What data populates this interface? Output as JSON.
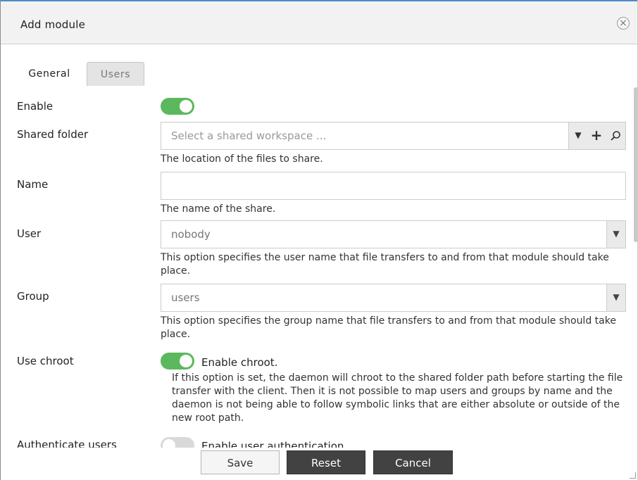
{
  "dialog": {
    "title": "Add module"
  },
  "tabs": [
    {
      "label": "General"
    },
    {
      "label": "Users"
    }
  ],
  "form": {
    "enable": {
      "label": "Enable",
      "on": true
    },
    "shared_folder": {
      "label": "Shared folder",
      "placeholder": "Select a shared workspace ...",
      "help": "The location of the files to share."
    },
    "name": {
      "label": "Name",
      "value": "",
      "help": "The name of the share."
    },
    "user": {
      "label": "User",
      "value": "nobody",
      "help": "This option specifies the user name that file transfers to and from that module should take place."
    },
    "group": {
      "label": "Group",
      "value": "users",
      "help": "This option specifies the group name that file transfers to and from that module should take place."
    },
    "use_chroot": {
      "label": "Use chroot",
      "on": true,
      "checkbox_label": "Enable chroot.",
      "help": "If this option is set, the daemon will chroot to the shared folder path before starting the file transfer with the client. Then it is not possible to map users and groups by name and the daemon is not being able to follow symbolic links that are either absolute or outside of the new root path."
    },
    "authenticate_users": {
      "label": "Authenticate users",
      "on": false,
      "checkbox_label": "Enable user authentication"
    }
  },
  "buttons": {
    "save": "Save",
    "reset": "Reset",
    "cancel": "Cancel"
  },
  "colors": {
    "toggle_on": "#5cb85c",
    "dark_button": "#424242",
    "header_bg": "#f2f2f2"
  }
}
